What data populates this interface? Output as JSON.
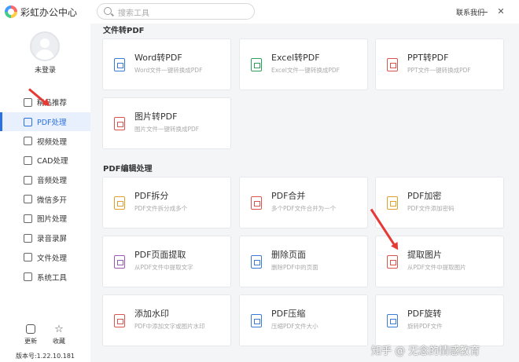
{
  "app": {
    "title": "彩虹办公中心"
  },
  "search": {
    "placeholder": "搜索工具"
  },
  "header": {
    "contact": "联系我们"
  },
  "user": {
    "status": "未登录"
  },
  "sidebar": {
    "items": [
      {
        "label": "精品推荐",
        "icon": "thumbs-up-icon",
        "active": false
      },
      {
        "label": "PDF处理",
        "icon": "pdf-icon",
        "active": true
      },
      {
        "label": "视频处理",
        "icon": "video-icon",
        "active": false
      },
      {
        "label": "CAD处理",
        "icon": "cad-icon",
        "active": false
      },
      {
        "label": "音频处理",
        "icon": "music-icon",
        "active": false
      },
      {
        "label": "微信多开",
        "icon": "wechat-icon",
        "active": false
      },
      {
        "label": "图片处理",
        "icon": "image-icon",
        "active": false
      },
      {
        "label": "录音录屏",
        "icon": "record-icon",
        "active": false
      },
      {
        "label": "文件处理",
        "icon": "folder-icon",
        "active": false
      },
      {
        "label": "系统工具",
        "icon": "toolbox-icon",
        "active": false
      }
    ],
    "update_label": "更新",
    "favorite_label": "收藏",
    "version": "版本号:1.22.10.181"
  },
  "sections": [
    {
      "title": "文件转PDF",
      "cards": [
        {
          "title": "Word转PDF",
          "desc": "Word文件一键转换成PDF",
          "color": "#3a7bd5"
        },
        {
          "title": "Excel转PDF",
          "desc": "Excel文件一键转换成PDF",
          "color": "#2e9e5b"
        },
        {
          "title": "PPT转PDF",
          "desc": "PPT文件一键转换成PDF",
          "color": "#d9534f"
        },
        {
          "title": "图片转PDF",
          "desc": "图片文件一键转换成PDF",
          "color": "#d9534f"
        }
      ]
    },
    {
      "title": "PDF编辑处理",
      "cards": [
        {
          "title": "PDF拆分",
          "desc": "PDF文件拆分成多个",
          "color": "#e0a030"
        },
        {
          "title": "PDF合并",
          "desc": "多个PDF文件合并为一个",
          "color": "#d9534f"
        },
        {
          "title": "PDF加密",
          "desc": "PDF文件添加密码",
          "color": "#e0a030"
        },
        {
          "title": "PDF页面提取",
          "desc": "从PDF文件中提取文字",
          "color": "#9b59b6"
        },
        {
          "title": "删除页面",
          "desc": "删除PDF中的页面",
          "color": "#3a7bd5"
        },
        {
          "title": "提取图片",
          "desc": "从PDF文件中提取图片",
          "color": "#d9534f"
        },
        {
          "title": "添加水印",
          "desc": "PDF中添加文字或图片水印",
          "color": "#d9534f"
        },
        {
          "title": "PDF压缩",
          "desc": "压缩PDF文件大小",
          "color": "#3a7bd5"
        },
        {
          "title": "PDF旋转",
          "desc": "旋转PDF文件",
          "color": "#3a7bd5"
        }
      ]
    }
  ],
  "watermark": "知乎 @ 无念的情感教育",
  "colors": {
    "accent": "#2b6fe0",
    "arrow": "#e53935"
  }
}
